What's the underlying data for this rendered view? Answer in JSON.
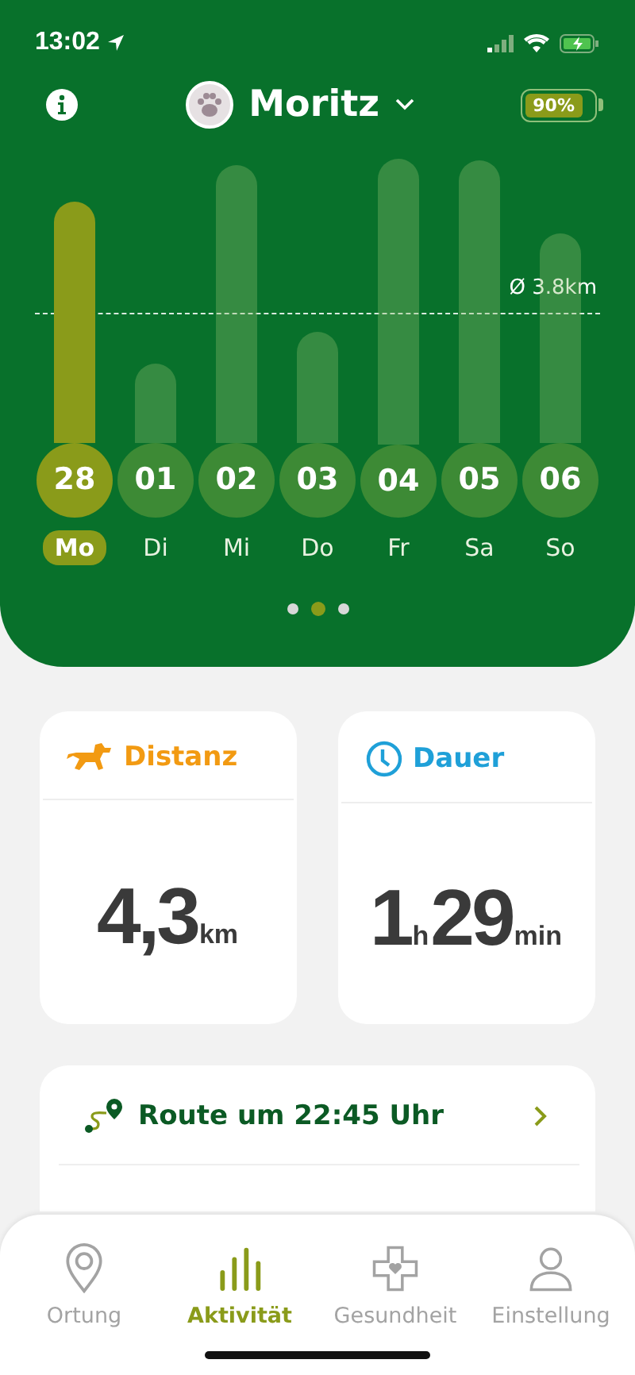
{
  "status_bar": {
    "time": "13:02"
  },
  "header": {
    "pet_name": "Moritz",
    "battery": "90%"
  },
  "chart": {
    "average": "Ø 3.8km",
    "days": [
      {
        "date": "28",
        "weekday": "Mo",
        "selected": true
      },
      {
        "date": "01",
        "weekday": "Di",
        "selected": false
      },
      {
        "date": "02",
        "weekday": "Mi",
        "selected": false
      },
      {
        "date": "03",
        "weekday": "Do",
        "selected": false
      },
      {
        "date": "04",
        "weekday": "Fr",
        "selected": false
      },
      {
        "date": "05",
        "weekday": "Sa",
        "selected": false
      },
      {
        "date": "06",
        "weekday": "So",
        "selected": false
      }
    ],
    "pages": [
      {
        "selected": false
      },
      {
        "selected": true
      },
      {
        "selected": false
      }
    ]
  },
  "stats": [
    {
      "kind": "distance",
      "title": "Distanz",
      "value": "4,3",
      "unit": "km"
    },
    {
      "kind": "duration",
      "title": "Dauer",
      "hours": "1",
      "hours_unit": "h",
      "minutes": "29",
      "minutes_unit": "min"
    }
  ],
  "route": {
    "title": "Route um 22:45 Uhr"
  },
  "tab_bar": [
    {
      "kind": "location",
      "label": "Ortung",
      "selected": false
    },
    {
      "kind": "activity",
      "label": "Aktivität",
      "selected": true
    },
    {
      "kind": "health",
      "label": "Gesundheit",
      "selected": false
    },
    {
      "kind": "settings",
      "label": "Einstellung",
      "selected": false
    }
  ]
}
